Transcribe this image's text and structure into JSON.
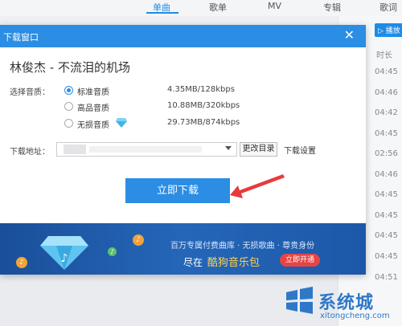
{
  "background": {
    "tabs": [
      "单曲",
      "歌单",
      "MV",
      "专辑",
      "歌词"
    ],
    "play_button": "▷ 播放",
    "duration_header": "时长",
    "durations": [
      "04:45",
      "04:46",
      "04:42",
      "04:45",
      "02:56",
      "04:46",
      "04:45",
      "04:45",
      "04:45",
      "04:45",
      "04:51"
    ]
  },
  "dialog": {
    "title": "下载窗口",
    "song": "林俊杰 - 不流泪的机场",
    "quality_label": "选择音质：",
    "qualities": [
      {
        "name": "标准音质",
        "size": "4.35MB/128kbps",
        "checked": true
      },
      {
        "name": "高品音质",
        "size": "10.88MB/320kbps",
        "checked": false
      },
      {
        "name": "无损音质",
        "size": "29.73MB/874kbps",
        "checked": false
      }
    ],
    "path_label": "下载地址：",
    "change_dir": "更改目录",
    "download_settings": "下载设置",
    "download_now": "立即下载"
  },
  "banner": {
    "line1": "百万专属付费曲库 · 无损歌曲 · 尊贵身份",
    "line2_prefix": "尽在",
    "brand": "酷狗音乐包",
    "open_button": "立即开通"
  },
  "watermark": {
    "text": "系统城",
    "url": "xitongcheng.com"
  },
  "colors": {
    "accent": "#2b8de3",
    "banner_bg": "#2566b8",
    "open_button": "#e64545",
    "brand_text": "#ffd34d",
    "arrow": "#e83a3a"
  }
}
